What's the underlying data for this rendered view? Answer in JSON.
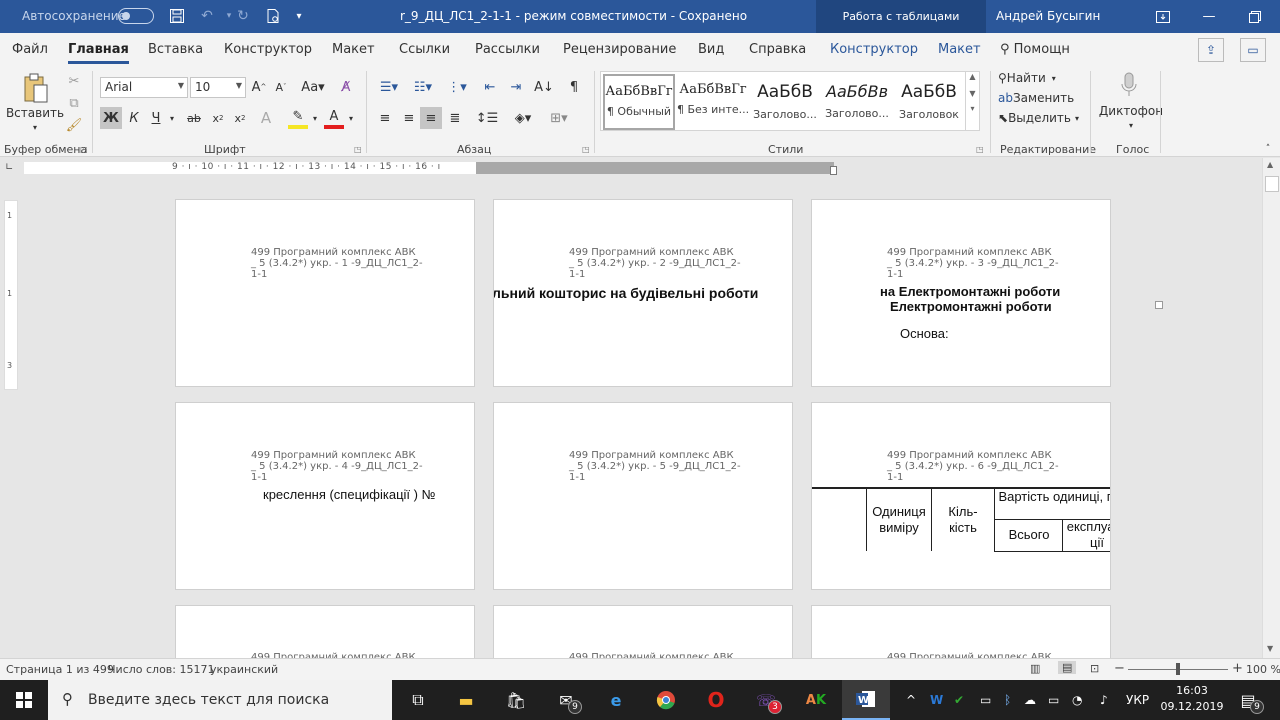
{
  "titlebar": {
    "autosave": "Автосохранение",
    "doc_title": "r_9_ДЦ_ЛС1_2-1-1  -  режим совместимости  -  Сохранено",
    "context_tab": "Работа с таблицами",
    "user": "Андрей Бусыгин"
  },
  "menu": {
    "tabs": [
      "Файл",
      "Главная",
      "Вставка",
      "Конструктор",
      "Макет",
      "Ссылки",
      "Рассылки",
      "Рецензирование",
      "Вид",
      "Справка",
      "Конструктор",
      "Макет"
    ],
    "tell_me": "Помощн"
  },
  "ribbon": {
    "clipboard": {
      "paste": "Вставить",
      "label": "Буфер обмена"
    },
    "font": {
      "name": "Arial",
      "size": "10",
      "label": "Шрифт",
      "bold": "Ж",
      "italic": "К",
      "underline": "Ч"
    },
    "paragraph": {
      "label": "Абзац"
    },
    "styles": {
      "label": "Стили",
      "items": [
        {
          "sample": "АаБбВвГг",
          "name": "¶ Обычный"
        },
        {
          "sample": "АаБбВвГг",
          "name": "¶ Без инте..."
        },
        {
          "sample": "АаБбВ",
          "name": "Заголово..."
        },
        {
          "sample": "АаБбВв",
          "name": "Заголово..."
        },
        {
          "sample": "АаБбВ",
          "name": "Заголовок"
        }
      ]
    },
    "editing": {
      "find": "Найти",
      "replace": "Заменить",
      "select": "Выделить",
      "label": "Редактирование"
    },
    "voice": {
      "dictate": "Диктофон",
      "label": "Голос"
    }
  },
  "ruler": {
    "numbers": "9 · ı · 10 · ı · 11 · ı · 12 · ı · 13 · ı · 14 · ı · 15 · ı · 16 · ı"
  },
  "pages": {
    "header_prefix": "499 Програмний комплекс АВК _ 5 (3.4.2*) укр. -",
    "header_suffix": "-9_ДЦ_ЛС1_2-1-1",
    "p1": {
      "num": "1"
    },
    "p2": {
      "num": "2",
      "title": "льний кошторис на будівельні роботи"
    },
    "p3": {
      "num": "3",
      "line1": "на Електромонтажні роботи",
      "line2": "Електромонтажні роботи",
      "basis": "Основа:"
    },
    "p4": {
      "num": "4",
      "text": "креслення (специфікації ) №"
    },
    "p5": {
      "num": "5"
    },
    "p6": {
      "num": "6",
      "unit": "Одиниця виміру",
      "qty": "Кіль-кість",
      "cost": "Вартість одиниці, грн.",
      "total": "Всього",
      "exploit": "експлуатації"
    },
    "partial": "499 Програмний комплекс АВК"
  },
  "status": {
    "page": "Страница 1 из 499",
    "words": "Число слов: 15171",
    "lang": "украинский",
    "zoom": "100 %",
    "zoom_level": 0.5
  },
  "taskbar": {
    "search_placeholder": "Введите здесь текст для поиска",
    "mail_badge": "9",
    "viber_badge": "3",
    "lang": "УКР",
    "time": "16:03",
    "date": "09.12.2019",
    "notif_badge": "9"
  }
}
